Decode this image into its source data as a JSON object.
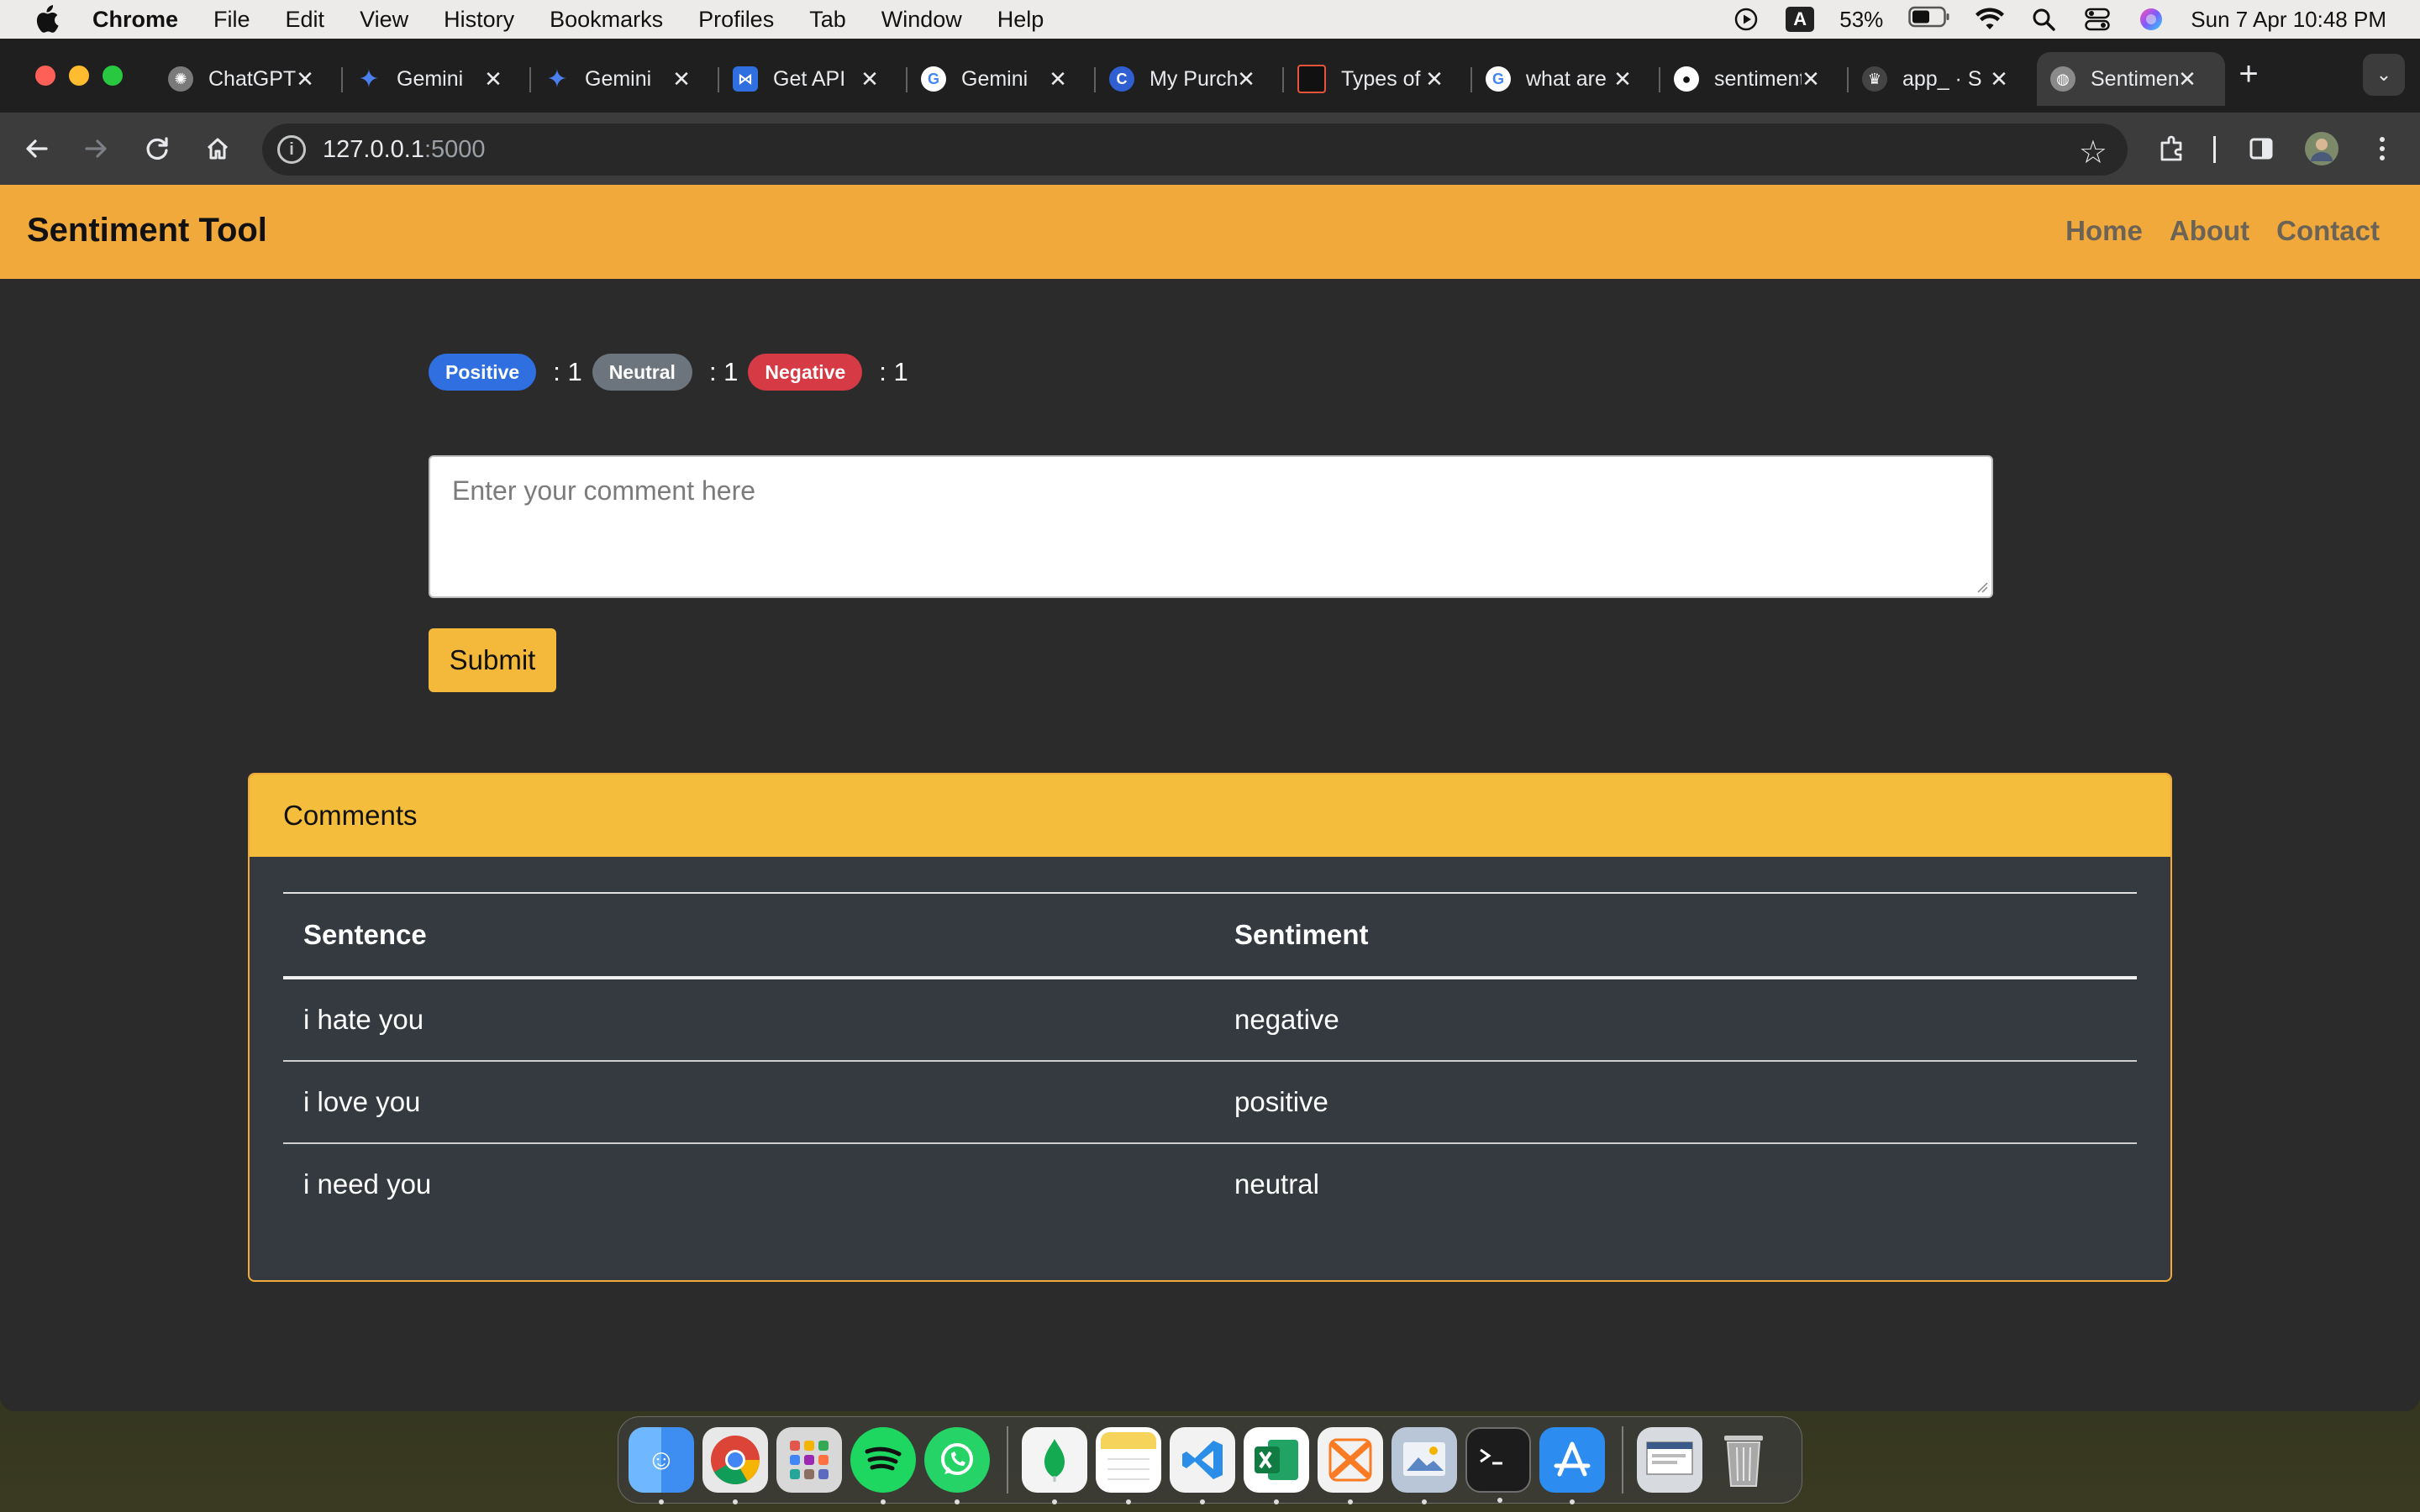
{
  "menubar": {
    "app": "Chrome",
    "items": [
      "File",
      "Edit",
      "View",
      "History",
      "Bookmarks",
      "Profiles",
      "Tab",
      "Window",
      "Help"
    ],
    "battery": "53%",
    "datetime": "Sun 7 Apr  10:48 PM",
    "input_source": "A"
  },
  "tabs": [
    {
      "title": "ChatGPT",
      "icon": "chatgpt-icon",
      "color": "#7a7a7a"
    },
    {
      "title": "Gemini",
      "icon": "gemini-icon",
      "color": "#4a7ff0"
    },
    {
      "title": "Gemini",
      "icon": "gemini-icon",
      "color": "#4a7ff0"
    },
    {
      "title": "Get API",
      "icon": "api-icon",
      "color": "#2f6fe0"
    },
    {
      "title": "Gemini",
      "icon": "google-icon",
      "color": "#ffffff"
    },
    {
      "title": "My Purchases",
      "icon": "c-icon",
      "color": "#2f5fd0"
    },
    {
      "title": "Types of",
      "icon": "doc-icon",
      "color": "#111111"
    },
    {
      "title": "what are",
      "icon": "google-icon",
      "color": "#ffffff"
    },
    {
      "title": "sentiment",
      "icon": "github-icon",
      "color": "#ffffff"
    },
    {
      "title": "app_ · S",
      "icon": "streamlit-icon",
      "color": "#444444"
    },
    {
      "title": "Sentiment",
      "icon": "globe-icon",
      "color": "#8a8a8a",
      "active": true
    }
  ],
  "address": {
    "host": "127.0.0.1",
    "port": ":5000"
  },
  "page": {
    "brand": "Sentiment Tool",
    "nav": [
      "Home",
      "About",
      "Contact"
    ],
    "counts": {
      "positive_label": "Positive",
      "positive_value": ": 1",
      "neutral_label": "Neutral",
      "neutral_value": ": 1",
      "negative_label": "Negative",
      "negative_value": ": 1"
    },
    "comment_placeholder": "Enter your comment here",
    "submit_label": "Submit",
    "comments": {
      "header": "Comments",
      "columns": [
        "Sentence",
        "Sentiment"
      ],
      "rows": [
        {
          "sentence": "i hate you",
          "sentiment": "negative"
        },
        {
          "sentence": "i love you",
          "sentiment": "positive"
        },
        {
          "sentence": "i need you",
          "sentiment": "neutral"
        }
      ]
    }
  },
  "colors": {
    "navbar": "#f0a93a",
    "card_header": "#f5bd3c",
    "positive": "#2f6fe0",
    "neutral": "#6c757d",
    "negative": "#d63a45"
  },
  "dock": [
    {
      "name": "finder-icon",
      "color": "#3d8ef0"
    },
    {
      "name": "chrome-icon",
      "color": "#e8e8e8"
    },
    {
      "name": "launchpad-icon",
      "color": "#d8d8d8"
    },
    {
      "name": "spotify-icon",
      "color": "#1ed760"
    },
    {
      "name": "whatsapp-icon",
      "color": "#25d366"
    },
    {
      "name": "mongodb-icon",
      "color": "#f4f4f4"
    },
    {
      "name": "notes-icon",
      "color": "#f6d35b"
    },
    {
      "name": "vscode-icon",
      "color": "#2a8ee8"
    },
    {
      "name": "excel-icon",
      "color": "#1f7a43"
    },
    {
      "name": "xampp-icon",
      "color": "#f2f2f2"
    },
    {
      "name": "preview-icon",
      "color": "#b9c6d8"
    },
    {
      "name": "terminal-icon",
      "color": "#1c1c1c"
    },
    {
      "name": "app-store-icon",
      "color": "#2d8cf0"
    },
    {
      "name": "downloads-stack-icon",
      "color": "#d7dbe0"
    },
    {
      "name": "trash-icon",
      "color": "#9a9a9a"
    }
  ]
}
